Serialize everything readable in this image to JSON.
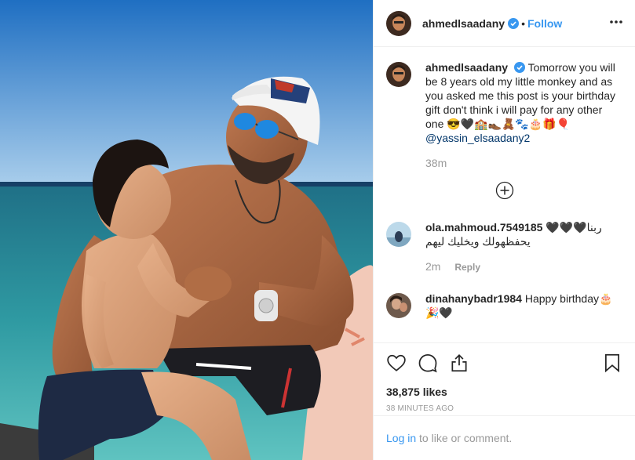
{
  "post": {
    "username": "ahmedlsaadany",
    "follow_label": "Follow",
    "separator": "•"
  },
  "caption": {
    "username": "ahmedlsaadany",
    "text": "Tomorrow you will be 8 years old my little monkey and as you asked me this post is your birthday gift don't think i will pay for any other one 😎🖤🏫👞🧸🐾🎂🎁🎈",
    "mention": "@yassin_elsaadany2",
    "time": "38m"
  },
  "comments": [
    {
      "username": "ola.mahmoud.7549185",
      "text": "ربنا🖤🖤🖤 يحفظهولك ويخليك ليهم",
      "time": "2m",
      "reply_label": "Reply"
    },
    {
      "username": "dinahanybadr1984",
      "text": "Happy birthday🎂🎉🖤"
    }
  ],
  "likes": "38,875 likes",
  "timestamp": "38 MINUTES AGO",
  "login": {
    "link": "Log in",
    "text": " to like or comment."
  },
  "colors": {
    "accent": "#3897f0",
    "muted": "#999999",
    "border": "#efefef"
  },
  "icons": [
    "verified-badge-icon",
    "more-options-icon",
    "load-more-icon",
    "heart-icon",
    "comment-icon",
    "share-icon",
    "bookmark-icon"
  ]
}
